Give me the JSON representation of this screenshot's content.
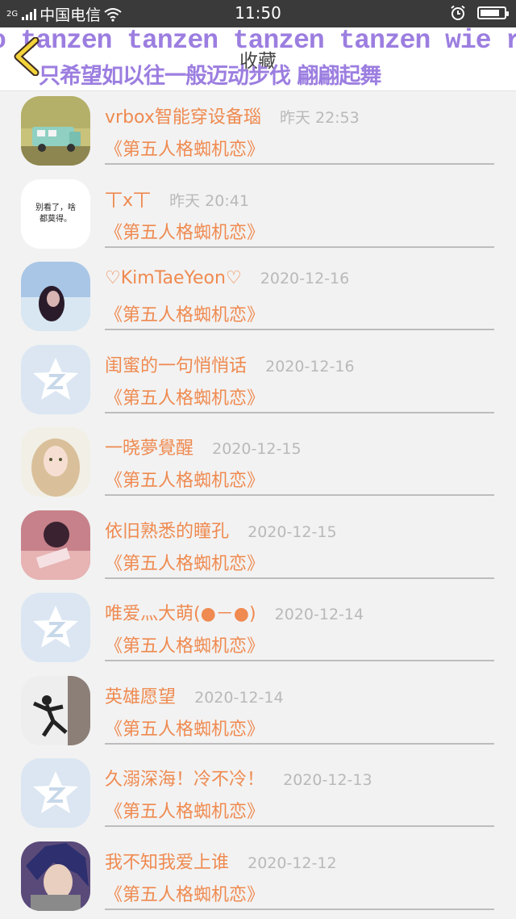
{
  "status": {
    "signal_label": "2G",
    "carrier": "中国电信",
    "time": "11:50",
    "battery_level": 0.82
  },
  "header": {
    "title": "收藏",
    "marquee": "o tanzen tanzen tanzen tanzen wie r",
    "subtitle": "只希望如以往一般迈动步伐 翩翩起舞"
  },
  "list": [
    {
      "name": "vrbox智能穿设备瑙",
      "time": "昨天 22:53",
      "fav": "《第五人格蜘机恋》",
      "avatar": "van"
    },
    {
      "name": "丅x丅",
      "time": "昨天 20:41",
      "fav": "《第五人格蜘机恋》",
      "avatar": "text",
      "avatar_text": "别看了，啥都莫得。"
    },
    {
      "name": "♡KimTaeYeon♡",
      "time": "2020-12-16",
      "fav": "《第五人格蜘机恋》",
      "avatar": "girl-blue"
    },
    {
      "name": "闺蜜的一句悄悄话",
      "time": "2020-12-16",
      "fav": "《第五人格蜘机恋》",
      "avatar": "qq"
    },
    {
      "name": "一晓夢覺醒",
      "time": "2020-12-15",
      "fav": "《第五人格蜘机恋》",
      "avatar": "girl-blonde"
    },
    {
      "name": "依旧熟悉的瞳孔",
      "time": "2020-12-15",
      "fav": "《第五人格蜘机恋》",
      "avatar": "pink"
    },
    {
      "name": "唯爱灬大萌(●－●)",
      "time": "2020-12-14",
      "fav": "《第五人格蜘机恋》",
      "avatar": "qq"
    },
    {
      "name": "英雄愿望",
      "time": "2020-12-14",
      "fav": "《第五人格蜘机恋》",
      "avatar": "dancer"
    },
    {
      "name": "久溺深海！冷不冷！",
      "time": "2020-12-13",
      "fav": "《第五人格蜘机恋》",
      "avatar": "qq"
    },
    {
      "name": "我不知我爱上谁",
      "time": "2020-12-12",
      "fav": "《第五人格蜘机恋》",
      "avatar": "anime"
    }
  ],
  "colors": {
    "accent": "#ef8a50",
    "time": "#b9b9b9",
    "marquee": "#9c7ee0",
    "qq_icon": "#dbe6f2"
  }
}
